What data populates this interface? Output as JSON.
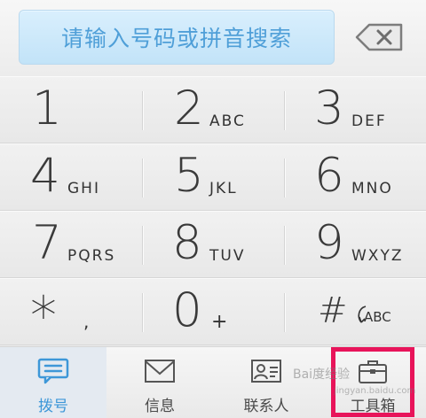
{
  "search": {
    "placeholder": "请输入号码或拼音搜索"
  },
  "icons": {
    "backspace": "backspace-icon",
    "dial": "dial-pad-icon",
    "messages": "envelope-icon",
    "contacts": "contact-card-icon",
    "toolbox": "briefcase-icon"
  },
  "keypad": {
    "k1": {
      "digit": "1",
      "letters": ""
    },
    "k2": {
      "digit": "2",
      "letters": "ABC"
    },
    "k3": {
      "digit": "3",
      "letters": "DEF"
    },
    "k4": {
      "digit": "4",
      "letters": "GHI"
    },
    "k5": {
      "digit": "5",
      "letters": "JKL"
    },
    "k6": {
      "digit": "6",
      "letters": "MNO"
    },
    "k7": {
      "digit": "7",
      "letters": "PQRS"
    },
    "k8": {
      "digit": "8",
      "letters": "TUV"
    },
    "k9": {
      "digit": "9",
      "letters": "WXYZ"
    },
    "star": {
      "digit": "*",
      "letters": ","
    },
    "k0": {
      "digit": "0",
      "letters": "+"
    },
    "hash": {
      "digit": "#",
      "letters": "ABC"
    }
  },
  "tabs": {
    "dial": "拨号",
    "messages": "信息",
    "contacts": "联系人",
    "toolbox": "工具箱"
  },
  "watermark": {
    "brand": "Bai度经验",
    "url": "jingyan.baidu.com"
  },
  "colors": {
    "accent": "#3d97d8",
    "highlight_box": "#e8145a",
    "search_bg": "#c9e7fa"
  }
}
